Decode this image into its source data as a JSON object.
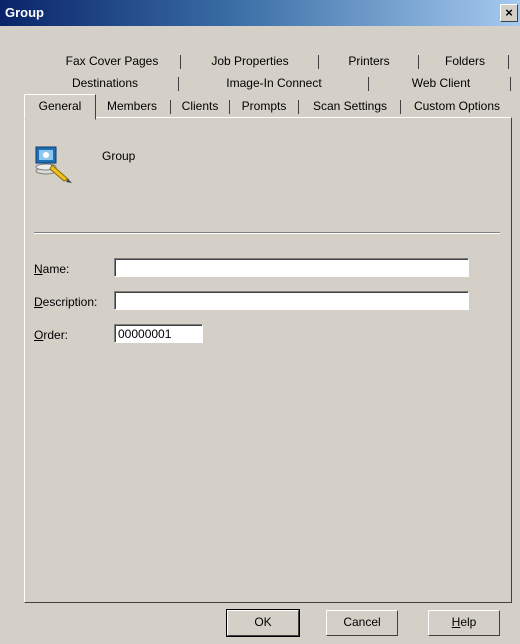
{
  "window": {
    "title": "Group",
    "close_glyph": "×"
  },
  "tabs": {
    "row1": [
      "Fax Cover Pages",
      "Job Properties",
      "Printers",
      "Folders"
    ],
    "row2": [
      "Destinations",
      "Image-In Connect",
      "Web Client"
    ],
    "row3": [
      "Members",
      "Clients",
      "Prompts",
      "Scan Settings",
      "Custom Options"
    ],
    "active": "General"
  },
  "header": {
    "icon": "group-icon",
    "title": "Group"
  },
  "form": {
    "name": {
      "label_mn": "N",
      "label_rest": "ame:",
      "value": ""
    },
    "description": {
      "label_mn": "D",
      "label_rest": "escription:",
      "value": ""
    },
    "order": {
      "label_mn": "O",
      "label_rest": "rder:",
      "value": "00000001"
    }
  },
  "buttons": {
    "ok": "OK",
    "cancel": "Cancel",
    "help_mn": "H",
    "help_rest": "elp"
  }
}
